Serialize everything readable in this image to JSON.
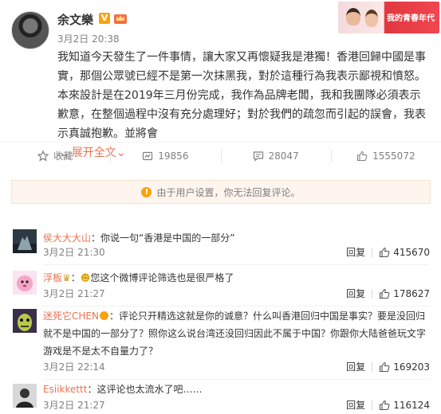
{
  "post": {
    "author": "余文樂",
    "vip_label": "V",
    "time": "3月2日 20:38",
    "banner_text": "我的青春年代",
    "body": "我知道今天發生了一件事情，讓大家又再懷疑我是港獨！香港回歸中國是事實，那個公眾號已經不是第一次抹黑我，對於這種行為我表示鄙視和憤怒。本來設計是在2019年三月份完成，我作為品牌老闆，我和我團隊必須表示歉意，在整個過程中沒有充分處理好；對於我們的疏忽而引起的誤會，我表示真誠抱歉。並將會",
    "ellipsis": "...",
    "expand": "展开全文",
    "expand_arrow": "⌄"
  },
  "actions": {
    "favorite": "收藏",
    "repost": "19856",
    "comment": "28047",
    "like": "1555072"
  },
  "notice": {
    "text": "由于用户设置，你无法回复评论。"
  },
  "comments": [
    {
      "name": "侯大大大山",
      "text": "：你说一句“香港是中国的一部分”",
      "time": "3月2日 21:30",
      "reply": "回复",
      "likes": "415670"
    },
    {
      "name": "浮板",
      "text": "您这个微博评论筛选也是很严格了",
      "time": "3月2日 21:27",
      "reply": "回复",
      "likes": "178627"
    },
    {
      "name": "迷死它CHEN",
      "text": "：评论只开精选这就是你的诚意？什么叫香港回归中国是事实？要是没回归就不是中国的一部分了？照你这么说台湾还没回归因此不属于中国？你跟你大陆爸爸玩文字游戏是不是太不自量力了？",
      "time": "3月2日 22:14",
      "reply": "回复",
      "likes": "169203"
    },
    {
      "name": "Esiikkettt",
      "text": "：这评论也太流水了吧……",
      "time": "3月2日 21:27",
      "reply": "回复",
      "likes": "116124"
    }
  ],
  "colors": {
    "accent": "#eb7350",
    "muted": "#808080",
    "notice_bg": "#fdf5ee",
    "badge": "#f7a211"
  }
}
